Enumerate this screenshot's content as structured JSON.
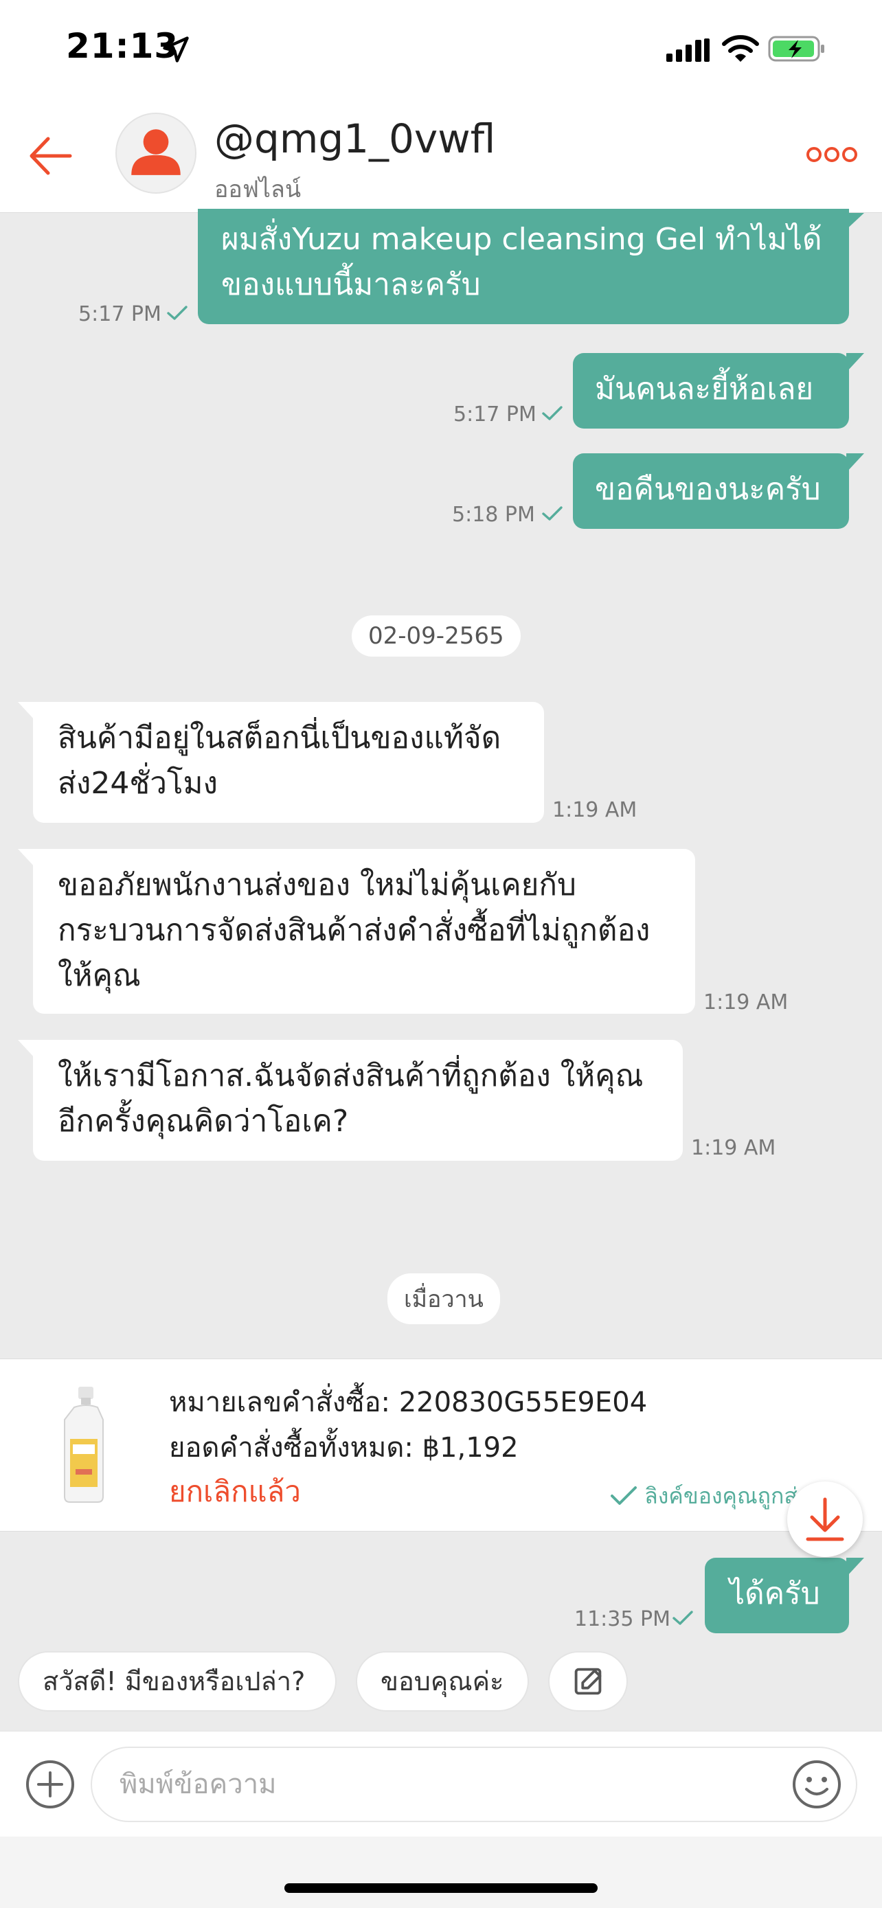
{
  "status_bar": {
    "time": "21:13"
  },
  "header": {
    "name": "@qmg1_0vwfl",
    "status": "ออฟไลน์"
  },
  "messages": [
    {
      "text": "ผมสั่งYuzu makeup cleansing Gel ทำไมได้ของแบบนี้มาละครับ",
      "line1": "ผมสั่งYuzu makeup cleansing Gel ทำไมได้",
      "line2": "ของแบบนี้มาละครับ",
      "time": "5:17 PM"
    },
    {
      "text": "มันคนละยี้ห้อเลย",
      "time": "5:17 PM"
    },
    {
      "text": "ขอคืนของนะครับ",
      "time": "5:18 PM"
    },
    {
      "text": "สินค้ามีอยู่ในสต็อกนี่เป็นของแท้จัดส่ง24ชั่วโมง",
      "line1": "สินค้ามีอยู่ในสต็อกนี่เป็นของแท้จัด",
      "line2": "ส่ง24ชั่วโมง",
      "time": "1:19 AM"
    },
    {
      "text": "ขออภัยพนักงานส่งของ ใหม่ไม่คุ้นเคยกับกระบวนการจัดส่งสินค้าส่งคำสั่งซื้อที่ไม่ถูกต้องให้คุณ",
      "line1": "ขออภัยพนักงานส่งของ ใหม่ไม่คุ้นเคยกับ",
      "line2": "กระบวนการจัดส่งสินค้าส่งคำสั่งซื้อที่ไม่ถูกต้อง",
      "line3": "ให้คุณ",
      "time": "1:19 AM"
    },
    {
      "text": "ให้เรามีโอกาส.ฉันจัดส่งสินค้าที่ถูกต้อง ให้คุณอีกครั้งคุณคิดว่าโอเค?",
      "line1": "ให้เรามีโอกาส.ฉันจัดส่งสินค้าที่ถูกต้อง ให้คุณ",
      "line2": "อีกครั้งคุณคิดว่าโอเค?",
      "time": "1:19 AM"
    },
    {
      "text": "ได้ครับ",
      "time": "11:35 PM"
    }
  ],
  "dates": {
    "first": "02-09-2565",
    "second": "เมื่อวาน"
  },
  "order": {
    "number": "หมายเลขคำสั่งซื้อ: 220830G55E9E04",
    "total": "ยอดคำสั่งซื้อทั้งหมด: ฿1,192",
    "status": "ยกเลิกแล้ว",
    "note": "ลิงค์ของคุณถูกส่งแล้ว"
  },
  "quick_replies": [
    "สวัสดี! มีของหรือเปล่า?",
    "ขอบคุณค่ะ"
  ],
  "input": {
    "placeholder": "พิมพ์ข้อความ"
  },
  "colors": {
    "accent": "#ee4d2d",
    "bubble_out": "#55ad9b",
    "background": "#ebebeb"
  },
  "icons": [
    "location-arrow-icon",
    "signal-icon",
    "wifi-icon",
    "battery-charging-icon",
    "back-arrow-icon",
    "avatar-person-icon",
    "more-dots-icon",
    "check-icon",
    "download-arrow-icon",
    "edit-icon",
    "add-icon",
    "emoji-icon"
  ]
}
